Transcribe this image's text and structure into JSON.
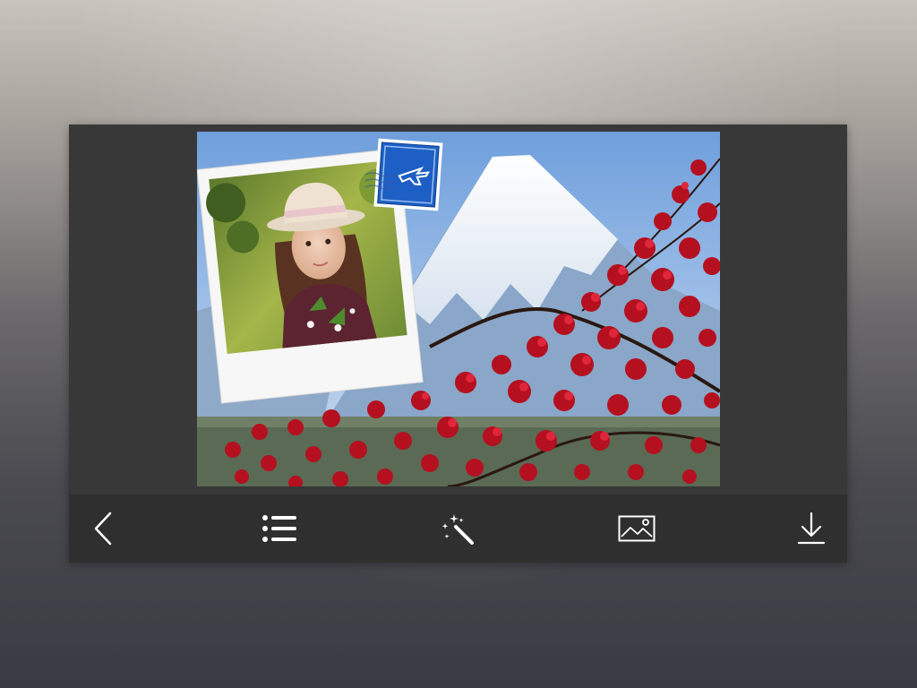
{
  "app": {
    "accent_color": "#ffffff",
    "toolbar_background": "#2f2f2f",
    "screen_background": "#383838"
  },
  "editor": {
    "frame_style": "polaroid-with-airmail-stamp",
    "scene": "mountain-and-red-blossoms"
  },
  "toolbar": {
    "items": [
      {
        "name": "back",
        "icon": "chevron-left-icon"
      },
      {
        "name": "frames-list",
        "icon": "list-icon"
      },
      {
        "name": "effects",
        "icon": "magic-wand-icon"
      },
      {
        "name": "gallery",
        "icon": "image-icon"
      },
      {
        "name": "save",
        "icon": "download-icon"
      }
    ]
  }
}
